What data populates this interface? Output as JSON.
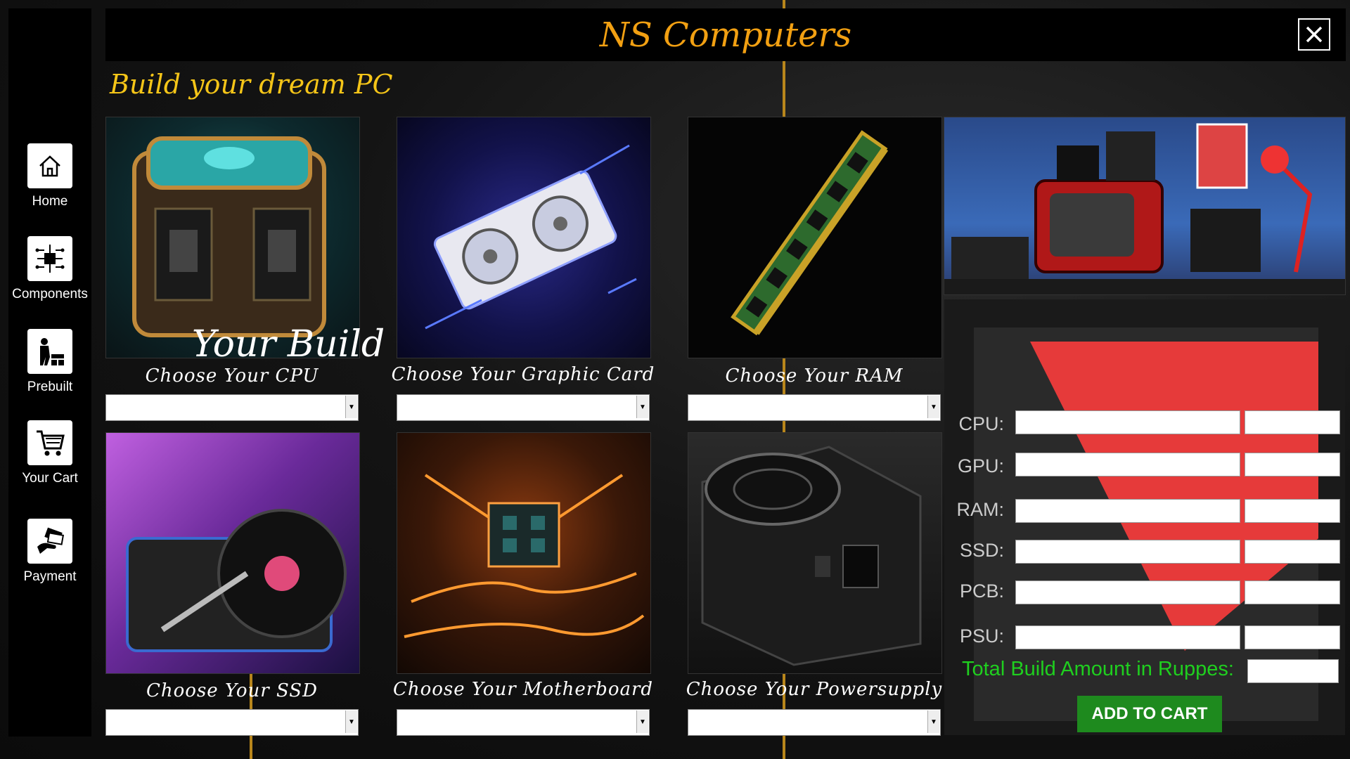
{
  "app": {
    "title": "NS Computers",
    "subtitle": "Build your dream PC"
  },
  "sidebar": {
    "items": [
      {
        "label": "Home",
        "icon": "home-icon"
      },
      {
        "label": "Components",
        "icon": "circuit-icon"
      },
      {
        "label": "Prebuilt",
        "icon": "builder-icon"
      },
      {
        "label": "Your Cart",
        "icon": "cart-icon"
      },
      {
        "label": "Payment",
        "icon": "payment-icon"
      }
    ]
  },
  "cards": [
    {
      "label": "Choose Your CPU",
      "image": "cpu-image"
    },
    {
      "label": "Choose Your Graphic Card",
      "image": "gpu-image"
    },
    {
      "label": "Choose Your RAM",
      "image": "ram-image"
    },
    {
      "label": "Choose Your SSD",
      "image": "ssd-image"
    },
    {
      "label": "Choose Your Motherboard",
      "image": "motherboard-image"
    },
    {
      "label": "Choose Your Powersupply",
      "image": "psu-image"
    }
  ],
  "build": {
    "title": "Your Build",
    "rows": [
      {
        "label": "CPU:"
      },
      {
        "label": "GPU:"
      },
      {
        "label": "RAM:"
      },
      {
        "label": "SSD:"
      },
      {
        "label": "PCB:"
      },
      {
        "label": "PSU:"
      }
    ],
    "total_label": "Total Build Amount in Ruppes:",
    "add_to_cart": "ADD TO CART"
  },
  "colors": {
    "accent": "#f2a012",
    "gold": "#f5c518",
    "success": "#1fcf1f",
    "button": "#1e8a1e"
  }
}
